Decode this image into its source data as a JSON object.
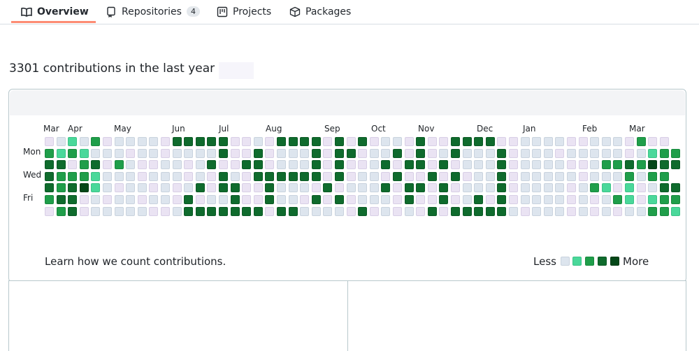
{
  "nav": {
    "tabs": [
      {
        "label": "Overview",
        "icon": "book-icon",
        "active": true
      },
      {
        "label": "Repositories",
        "icon": "repo-icon",
        "counter": "4"
      },
      {
        "label": "Projects",
        "icon": "project-icon"
      },
      {
        "label": "Packages",
        "icon": "package-icon"
      }
    ]
  },
  "heading": "3301 contributions in the last year",
  "calendar": {
    "months": [
      "Mar",
      "Apr",
      "May",
      "Jun",
      "Jul",
      "Aug",
      "Sep",
      "Oct",
      "Nov",
      "Dec",
      "Jan",
      "Feb",
      "Mar"
    ],
    "days": [
      "Mon",
      "Wed",
      "Fri"
    ],
    "grid": [
      "p0102p0000p33333pp0p3333p3p3p00p3pp3333pp0000pp000p2pp",
      "2121000p00p00003pp3p0003p33p003p3p030003p000p00000p0122",
      "33p23p20pp00p03pp33p0003p3pp03p33p3p0003p0000pp02232433",
      "32221000p000p0p30p333333p3p00p3pp3p3p003p00000p0002022",
      "323410p00p0p03p33pp3000p3p0003p33p3p0003p0000p021p1p033",
      "233p0p00p00p3p003pp300p3p3p000p3pp3p03p3p0000p0p021p122",
      "p23p00000pp03333333p330000p3p0p0p3p333330p000p0p0p00221"
    ],
    "colors": {
      "empty": "#dde5ee",
      "l1": "#4ad89a",
      "l2": "#1f9e4a",
      "l3": "#0f6b2d",
      "l4": "#044718"
    }
  },
  "footer": {
    "learn_link": "Learn how we count contributions.",
    "legend_less": "Less",
    "legend_more": "More"
  }
}
